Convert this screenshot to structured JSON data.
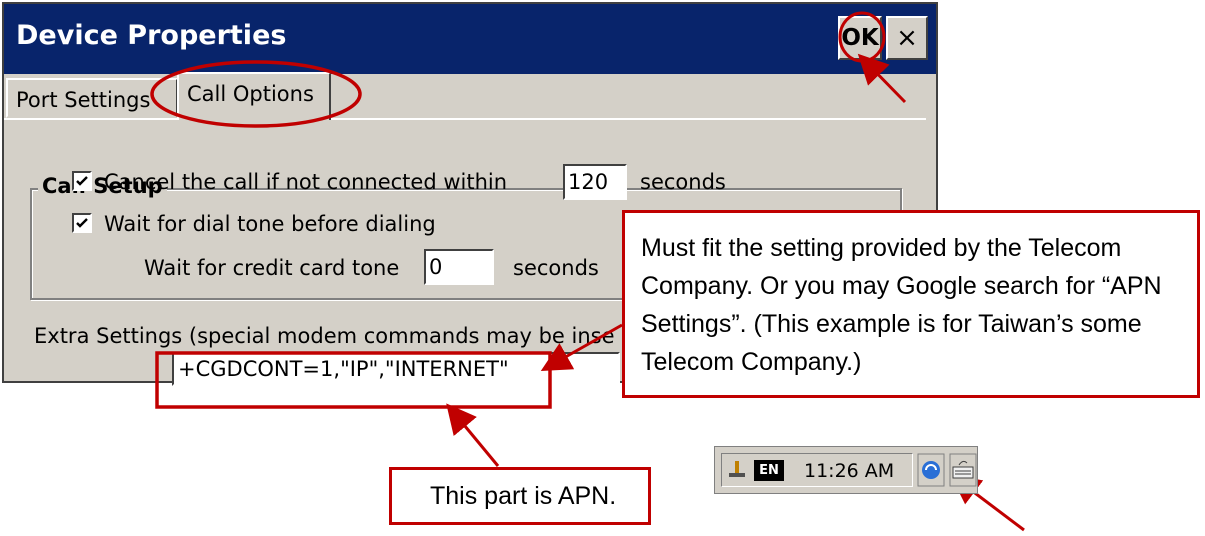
{
  "dialog": {
    "title": "Device Properties",
    "ok_label": "OK",
    "close_label": "×"
  },
  "tabs": [
    {
      "label": "Port Settings",
      "selected": false
    },
    {
      "label": "Call Options",
      "selected": true
    }
  ],
  "call_setup": {
    "group_label": "Call Setup",
    "cancel_call": {
      "label": "Cancel the call if not connected within",
      "checked": true,
      "value": "120",
      "unit": "seconds"
    },
    "wait_dial_tone": {
      "label": "Wait for dial tone before dialing",
      "checked": true
    },
    "credit_card": {
      "label": "Wait for credit card tone",
      "value": "0",
      "unit": "seconds"
    }
  },
  "extra_settings": {
    "label": "Extra Settings (special modem commands may be inse",
    "value": "+CGDCONT=1,\"IP\",\"INTERNET\""
  },
  "callouts": {
    "main": "Must fit the setting provided by the Telecom Company. Or you may Google search for “APN Settings”. (This example is for Taiwan’s some Telecom Company.)",
    "apn": "This part is APN."
  },
  "taskbar": {
    "language": "EN",
    "clock": "11:26 AM"
  },
  "colors": {
    "titlebar": "#08246b",
    "highlight": "#c00000",
    "dialog_bg": "#d4d0c8"
  }
}
